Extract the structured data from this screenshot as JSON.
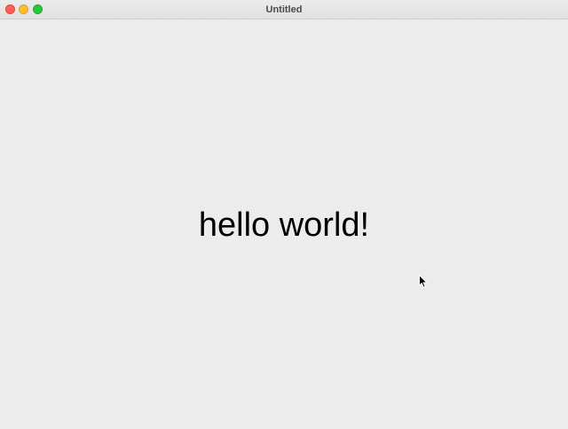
{
  "window": {
    "title": "Untitled"
  },
  "controls": {
    "close_icon": "close-traffic-light",
    "minimize_icon": "minimize-traffic-light",
    "maximize_icon": "maximize-traffic-light",
    "close_color": "#fe5f57",
    "minimize_color": "#febc2e",
    "maximize_color": "#28c840"
  },
  "content": {
    "text": "hello world!"
  },
  "pointer": {
    "icon": "arrow-cursor-icon"
  }
}
